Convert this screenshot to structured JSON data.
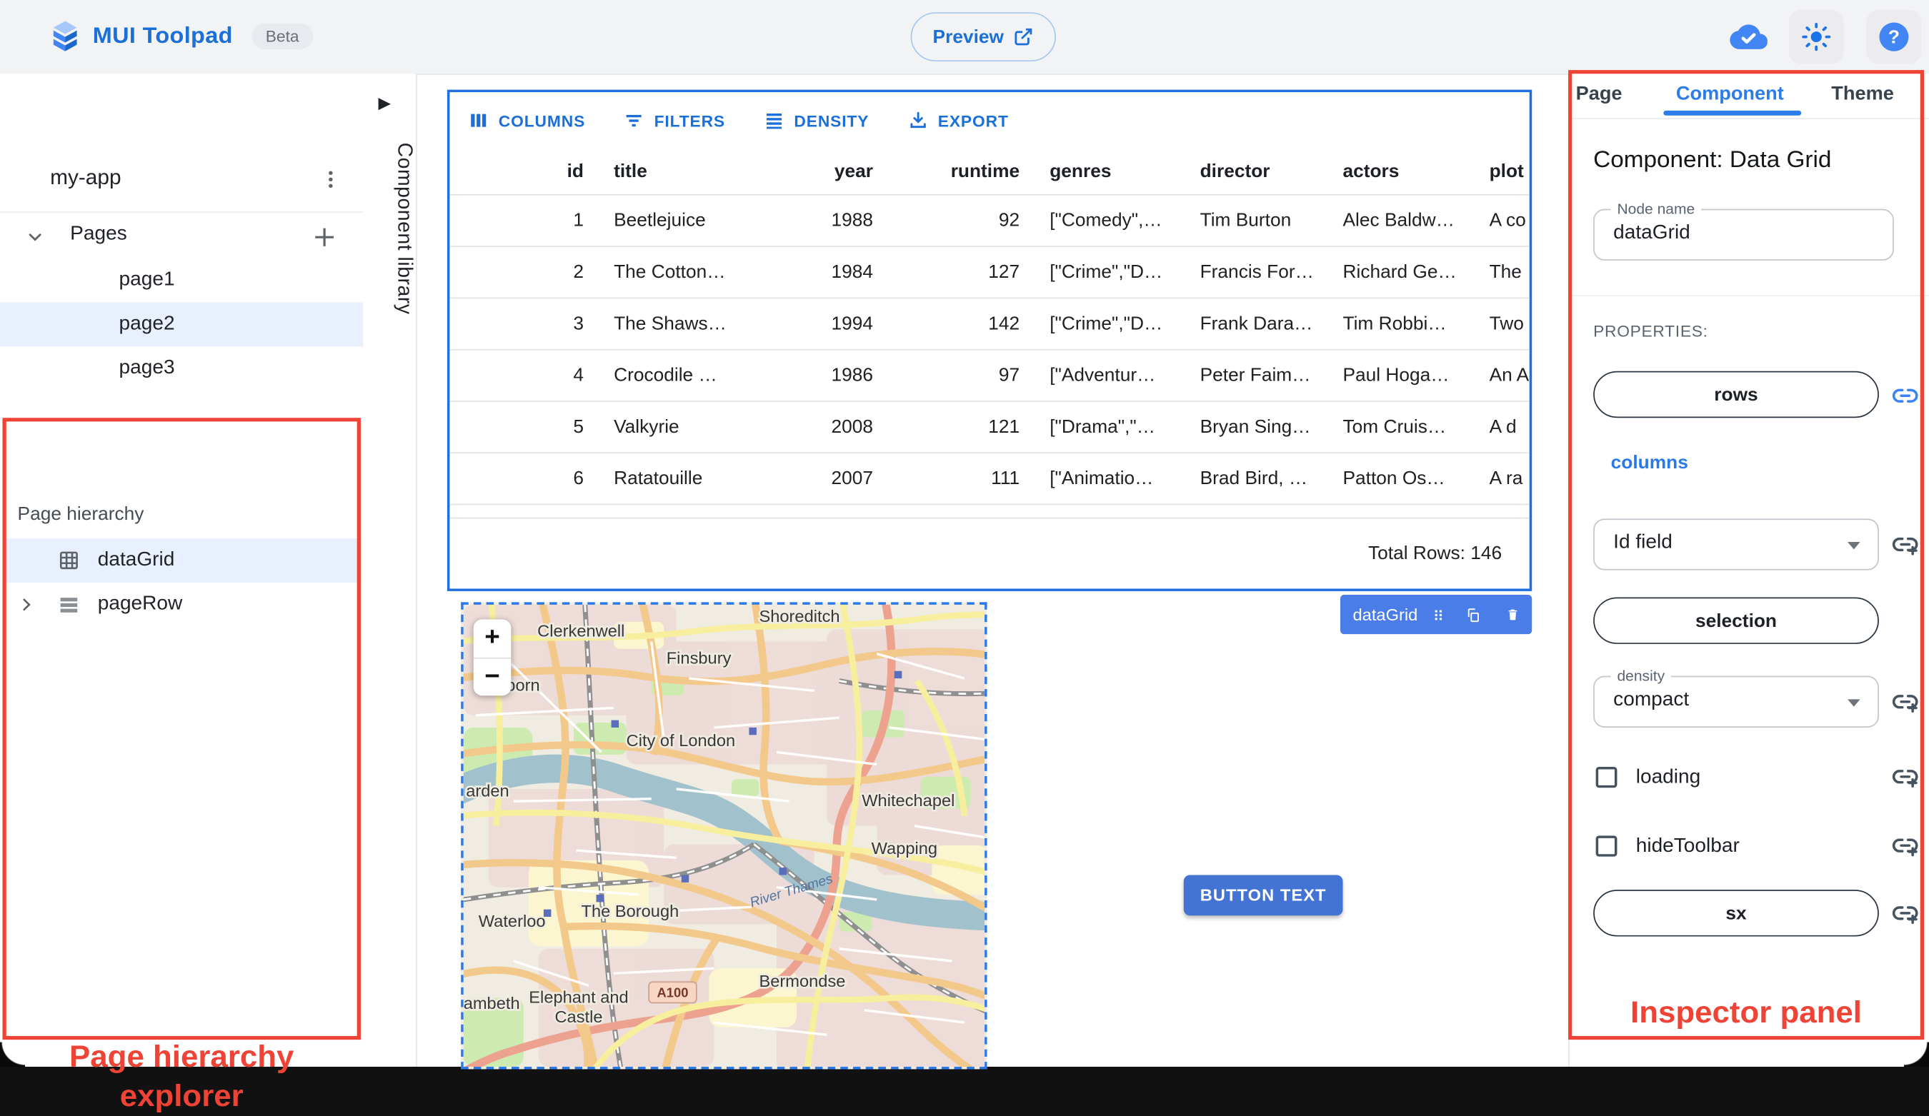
{
  "header": {
    "app_title": "MUI Toolpad",
    "beta_badge": "Beta",
    "preview_button": "Preview"
  },
  "sidebar": {
    "app_name": "my-app",
    "pages_label": "Pages",
    "pages": [
      "page1",
      "page2",
      "page3"
    ],
    "selected_page": "page2"
  },
  "hierarchy": {
    "title": "Page hierarchy",
    "items": [
      {
        "label": "dataGrid",
        "selected": true
      },
      {
        "label": "pageRow",
        "selected": false
      }
    ],
    "annotation_line1": "Page hierarchy",
    "annotation_line2": "explorer"
  },
  "component_library": {
    "label": "Component library"
  },
  "canvas": {
    "grid": {
      "toolbar": [
        "COLUMNS",
        "FILTERS",
        "DENSITY",
        "EXPORT"
      ],
      "columns": [
        "id",
        "title",
        "year",
        "runtime",
        "genres",
        "director",
        "actors",
        "plot"
      ],
      "rows": [
        [
          "1",
          "Beetlejuice",
          "1988",
          "92",
          "[\"Comedy\",…",
          "Tim Burton",
          "Alec Baldw…",
          "A co"
        ],
        [
          "2",
          "The Cotton…",
          "1984",
          "127",
          "[\"Crime\",\"D…",
          "Francis For…",
          "Richard Ge…",
          "The"
        ],
        [
          "3",
          "The Shaws…",
          "1994",
          "142",
          "[\"Crime\",\"D…",
          "Frank Dara…",
          "Tim Robbi…",
          "Two"
        ],
        [
          "4",
          "Crocodile …",
          "1986",
          "97",
          "[\"Adventur…",
          "Peter Faim…",
          "Paul Hoga…",
          "An A"
        ],
        [
          "5",
          "Valkyrie",
          "2008",
          "121",
          "[\"Drama\",\"…",
          "Bryan Sing…",
          "Tom Cruis…",
          "A d"
        ],
        [
          "6",
          "Ratatouille",
          "2007",
          "111",
          "[\"Animatio…",
          "Brad Bird, …",
          "Patton Os…",
          "A ra"
        ]
      ],
      "footer": "Total Rows: 146",
      "selection_chip": "dataGrid"
    },
    "map": {
      "zoom_in": "+",
      "zoom_out": "−",
      "labels": {
        "shoreditch": "Shoreditch",
        "clerkenwell": "Clerkenwell",
        "finsbury": "Finsbury",
        "holborn": "born",
        "covent_garden": "arden",
        "city": "City of London",
        "whitechapel": "Whitechapel",
        "wapping": "Wapping",
        "waterloo": "Waterloo",
        "borough": "The Borough",
        "lambeth": "ambeth",
        "elephant_line1": "Elephant and",
        "elephant_line2": "Castle",
        "bermondsey": "Bermondse",
        "river": "River Thames",
        "road_shield": "A100"
      }
    },
    "button_label": "BUTTON TEXT"
  },
  "inspector": {
    "tabs": [
      "Page",
      "Component",
      "Theme"
    ],
    "active_tab": "Component",
    "heading": "Component: Data Grid",
    "node_name": {
      "label": "Node name",
      "value": "dataGrid"
    },
    "properties_label": "PROPERTIES:",
    "rows_button": "rows",
    "columns_link": "columns",
    "id_field_value": "Id field",
    "selection_button": "selection",
    "density": {
      "label": "density",
      "value": "compact"
    },
    "loading_label": "loading",
    "hide_toolbar_label": "hideToolbar",
    "sx_button": "sx",
    "annotation": "Inspector panel"
  },
  "colors": {
    "accent": "#1a6fd8",
    "selection_border": "#1f6fe0",
    "chip_blue": "#4a7de8",
    "button_blue": "#4374d4",
    "annotation_red": "#ee4335"
  }
}
